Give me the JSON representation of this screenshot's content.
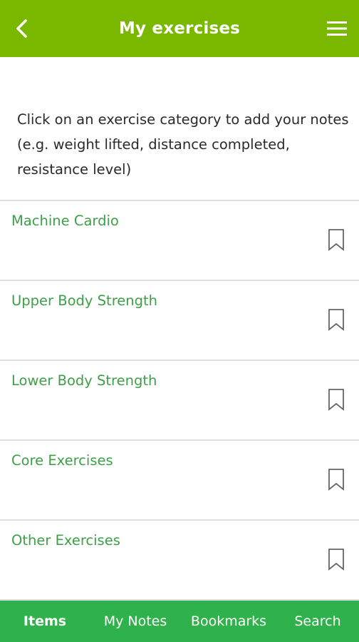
{
  "header": {
    "title": "My exercises",
    "back_icon": "chevron-left-icon",
    "menu_icon": "hamburger-menu-icon",
    "color": "#7ab800"
  },
  "intro": {
    "text": "Click on an exercise category to add your notes (e.g. weight lifted, distance completed, resistance level)"
  },
  "categories": [
    {
      "label": "Machine Cardio",
      "icon": "bookmark-icon"
    },
    {
      "label": "Upper Body Strength",
      "icon": "bookmark-icon"
    },
    {
      "label": "Lower Body Strength",
      "icon": "bookmark-icon"
    },
    {
      "label": "Core Exercises",
      "icon": "bookmark-icon"
    },
    {
      "label": "Other Exercises",
      "icon": "bookmark-icon"
    }
  ],
  "tabbar": {
    "color": "#2fb14b",
    "tabs": [
      {
        "label": "Items",
        "active": true
      },
      {
        "label": "My Notes",
        "active": false
      },
      {
        "label": "Bookmarks",
        "active": false
      },
      {
        "label": "Search",
        "active": false
      }
    ]
  },
  "colors": {
    "category_text": "#3f9f49",
    "divider": "#dedede"
  }
}
